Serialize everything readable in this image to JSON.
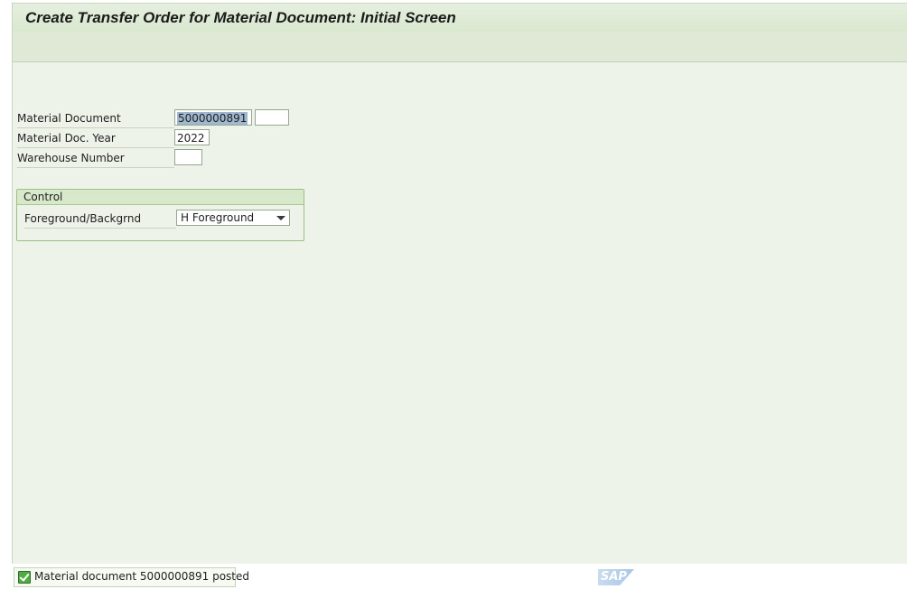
{
  "title": "Create Transfer Order for Material Document: Initial Screen",
  "fields": [
    {
      "label": "Material Document",
      "value": "5000000891",
      "extra_value": ""
    },
    {
      "label": "Material Doc. Year",
      "value": "2022"
    },
    {
      "label": "Warehouse Number",
      "value": ""
    }
  ],
  "control": {
    "title": "Control",
    "fg_bg_label": "Foreground/Backgrnd",
    "fg_bg_value": "H Foreground"
  },
  "status": {
    "message": "Material document 5000000891 posted",
    "icon": "success-check-icon"
  },
  "logo": "SAP",
  "colors": {
    "background": "#eef3ea",
    "title_bar": "#d9e8cf",
    "selection": "#9fb7cf",
    "group_border": "#9dbf84"
  }
}
